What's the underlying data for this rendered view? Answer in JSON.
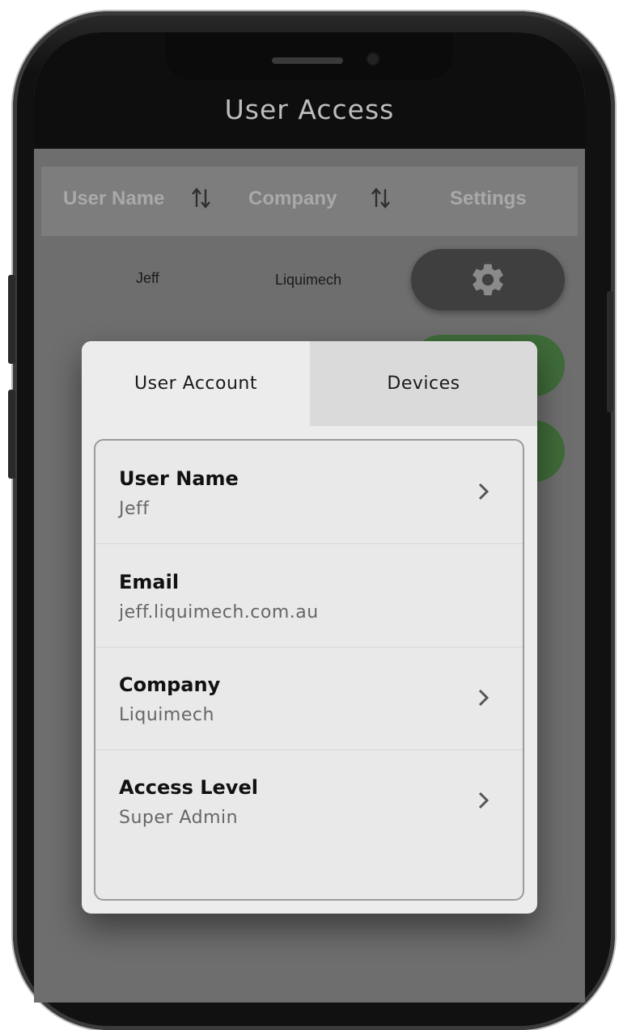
{
  "app": {
    "title": "User Access"
  },
  "table": {
    "headers": {
      "user_name": "User Name",
      "company": "Company",
      "settings": "Settings"
    },
    "rows": [
      {
        "user_name": "Jeff",
        "company": "Liquimech"
      }
    ]
  },
  "dialog": {
    "tabs": [
      {
        "label": "User Account",
        "active": true
      },
      {
        "label": "Devices",
        "active": false
      }
    ],
    "fields": [
      {
        "label": "User Name",
        "value": "Jeff"
      },
      {
        "label": "Email",
        "value": "jeff.liquimech.com.au"
      },
      {
        "label": "Company",
        "value": "Liquimech"
      },
      {
        "label": "Access Level",
        "value": "Super Admin"
      }
    ]
  },
  "icons": {
    "sort": "sort-arrows-icon",
    "settings": "gear-icon",
    "chevron": "chevron-right-icon"
  },
  "colors": {
    "appbar": "#0e0e0e",
    "accent_green": "#3f6b39",
    "gear_button": "#3f3f3f"
  }
}
